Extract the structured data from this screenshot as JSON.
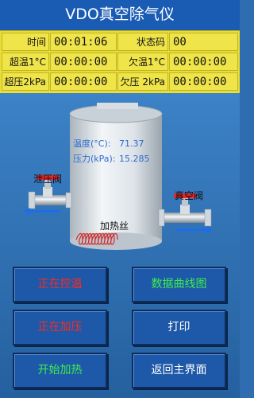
{
  "title": "VDO真空除气仪",
  "info": {
    "time_label": "时间",
    "time_value": "00:01:06",
    "status_label": "状态码",
    "status_value": "00",
    "overtemp_label": "超温1°C",
    "overtemp_value": "00:00:00",
    "undertemp_label": "欠温1°C",
    "undertemp_value": "00:00:00",
    "overpress_label": "超压2kPa",
    "overpress_value": "00:00:00",
    "underpress_label": "欠压 2kPa",
    "underpress_value": "00:00:00"
  },
  "tank": {
    "temp_label": "温度(°C):",
    "temp_value": "71.37",
    "press_label": "压力(kPa):",
    "press_value": "15.285",
    "heater_label": "加热丝",
    "relief_valve_label": "泄压阀",
    "vacuum_valve_label": "真空阀"
  },
  "buttons": {
    "temp_control": "正在控温",
    "data_curve": "数据曲线图",
    "pressurizing": "正在加压",
    "print": "打印",
    "start_heating": "开始加热",
    "back_home": "返回主界面"
  },
  "colors": {
    "background": "#2d6db0",
    "title_bar": "#1a5cb4",
    "info_panel": "#e8de35",
    "tank": "#e6ecf0",
    "valve_red": "#e3262a",
    "flow_arrow": "#1d6de8",
    "button_red_text": "#ff2a1f",
    "button_green_text": "#3cf04b"
  }
}
